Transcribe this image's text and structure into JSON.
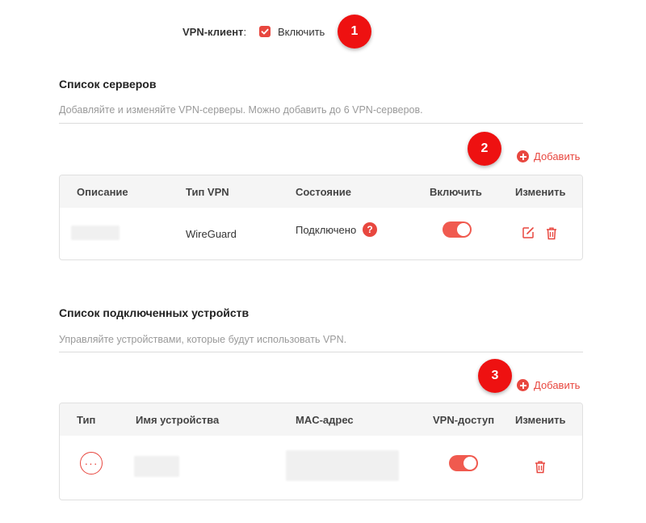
{
  "vpn_client": {
    "label": "VPN-клиент",
    "colon": ":",
    "enable_label": "Включить",
    "enabled": true
  },
  "callouts": [
    "1",
    "2",
    "3"
  ],
  "server_list": {
    "title": "Список серверов",
    "description": "Добавляйте и изменяйте VPN-серверы. Можно добавить до 6 VPN-серверов.",
    "add_label": "Добавить",
    "columns": [
      "Описание",
      "Тип VPN",
      "Состояние",
      "Включить",
      "Изменить"
    ],
    "rows": [
      {
        "description": "",
        "vpn_type": "WireGuard",
        "status": "Подключено",
        "help": "?",
        "enabled": true
      }
    ]
  },
  "device_list": {
    "title": "Список подключенных устройств",
    "description": "Управляйте устройствами, которые будут использовать VPN.",
    "add_label": "Добавить",
    "columns": [
      "Тип",
      "Имя устройства",
      "MAC-адрес",
      "VPN-доступ",
      "Изменить"
    ],
    "rows": [
      {
        "type_icon": "more-icon",
        "type_glyph": "···",
        "device_name": "",
        "mac": "",
        "vpn_access": true
      }
    ]
  },
  "colors": {
    "accent": "#e8473f",
    "callout": "#ee1111",
    "toggle_on": "#f05a4f",
    "header_bg": "#f5f5f5"
  }
}
